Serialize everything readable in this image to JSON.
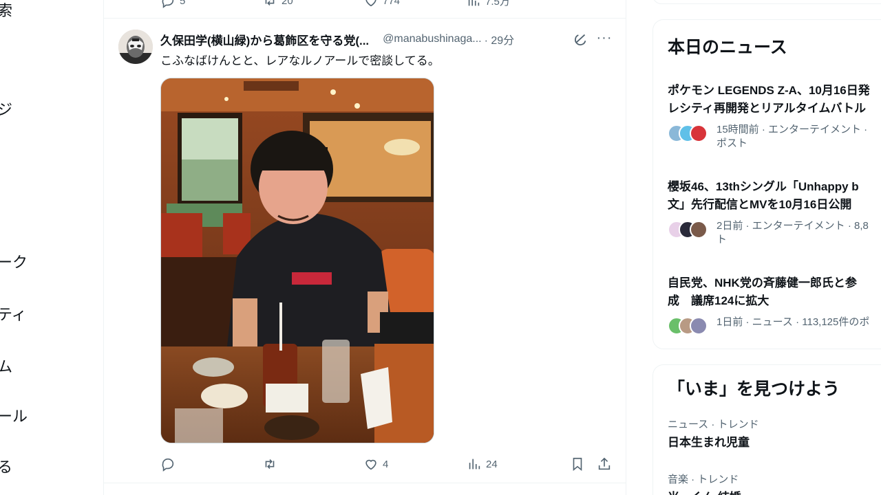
{
  "left_nav": {
    "items": [
      {
        "label": "索"
      },
      {
        "label": "ジ"
      },
      {
        "label": "ーク"
      },
      {
        "label": "ティ"
      },
      {
        "label": "ム"
      },
      {
        "label": "ール"
      },
      {
        "label": "る"
      }
    ]
  },
  "previous_tweet": {
    "reply_count": "5",
    "retweet_count": "20",
    "like_count": "774",
    "view_count": "7.5万"
  },
  "tweet": {
    "display_name": "久保田学(横山緑)から葛飾区を守る党(...",
    "handle": "@manabushinaga...",
    "time": "· 29分",
    "text": "こふなばけんとと、レアなルノアールで密談してる。",
    "reply_count": "",
    "retweet_count": "",
    "like_count": "4",
    "view_count": "24"
  },
  "sidebar": {
    "news_title": "本日のニュース",
    "news": [
      {
        "title_line1": "ポケモン LEGENDS Z-A、10月16日発",
        "title_line2": "レシティ再開発とリアルタイムバトル",
        "meta_line1": "15時間前 · エンターテイメント ·",
        "meta_line2": "ポスト"
      },
      {
        "title_line1": "櫻坂46、13thシングル「Unhappy b",
        "title_line2": "文」先行配信とMVを10月16日公開",
        "meta_line1": "2日前 · エンターテイメント · 8,8",
        "meta_line2": "ト"
      },
      {
        "title_line1": "自民党、NHK党の斉藤健一郎氏と参",
        "title_line2": "成　議席124に拡大",
        "meta_line1": "1日前 · ニュース · 113,125件のポ",
        "meta_line2": ""
      }
    ],
    "explore_title": "「いま」を見つけよう",
    "trends": [
      {
        "meta": "ニュース · トレンド",
        "name": "日本生まれ児童"
      },
      {
        "meta": "音楽 · トレンド",
        "name": "米ーくん 結婚"
      }
    ]
  },
  "colors": {
    "text_primary": "#0f1419",
    "text_secondary": "#536471",
    "border": "#eff3f4"
  }
}
